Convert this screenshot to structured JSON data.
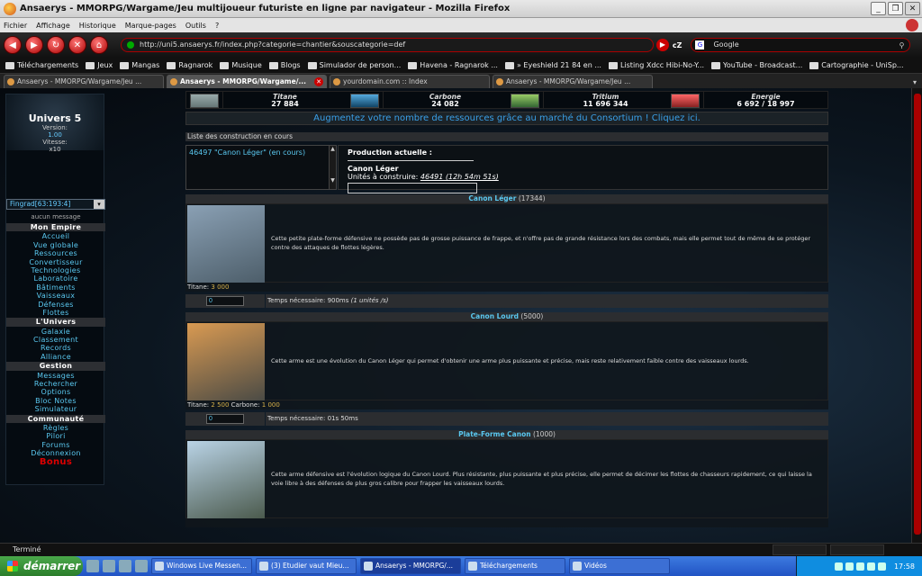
{
  "window": {
    "title": "Ansaerys - MMORPG/Wargame/Jeu multijoueur futuriste en ligne par navigateur - Mozilla Firefox"
  },
  "menu": [
    "Fichier",
    "Affichage",
    "Historique",
    "Marque-pages",
    "Outils",
    "?"
  ],
  "nav": {
    "url": "http://uni5.ansaerys.fr/index.php?categorie=chantier&souscategorie=def",
    "search": "Google"
  },
  "bookmarks": [
    "Téléchargements",
    "Jeux",
    "Mangas",
    "Ragnarok",
    "Musique",
    "Blogs",
    "Simulador de person...",
    "Havena - Ragnarok ...",
    "» Eyeshield 21 84 en ...",
    "Listing Xdcc Hibi-No-Y...",
    "YouTube - Broadcast...",
    "Cartographie - UniSp..."
  ],
  "tabs": [
    "Ansaerys - MMORPG/Wargame/Jeu ...",
    "Ansaerys - MMORPG/Wargame/...",
    "yourdomain.com :: Index",
    "Ansaerys - MMORPG/Wargame/Jeu ..."
  ],
  "sidebar": {
    "universe": "Univers 5",
    "version_label": "Version:",
    "version": "1.00",
    "speed_label": "Vitesse:",
    "speed": "x10",
    "planet": "Fingrad[63:193:4]",
    "message": "aucun message",
    "items": [
      {
        "label": "Mon Empire",
        "header": true
      },
      {
        "label": "Accueil"
      },
      {
        "label": "Vue globale"
      },
      {
        "label": "Ressources"
      },
      {
        "label": "Convertisseur"
      },
      {
        "label": "Technologies"
      },
      {
        "label": "Laboratoire"
      },
      {
        "label": "Bâtiments"
      },
      {
        "label": "Vaisseaux"
      },
      {
        "label": "Défenses"
      },
      {
        "label": "Flottes"
      },
      {
        "label": "L'Univers",
        "header": true
      },
      {
        "label": "Galaxie"
      },
      {
        "label": "Classement"
      },
      {
        "label": "Records"
      },
      {
        "label": "Alliance"
      },
      {
        "label": "Gestion",
        "header": true
      },
      {
        "label": "Messages"
      },
      {
        "label": "Rechercher"
      },
      {
        "label": "Options"
      },
      {
        "label": "Bloc Notes"
      },
      {
        "label": "Simulateur"
      },
      {
        "label": "Communauté",
        "header": true
      },
      {
        "label": "Règles"
      },
      {
        "label": "Pilori"
      },
      {
        "label": "Forums"
      },
      {
        "label": "Déconnexion"
      },
      {
        "label": "Bonus",
        "bonus": true
      }
    ]
  },
  "resources": [
    {
      "name": "Titane",
      "value": "27 884"
    },
    {
      "name": "Carbone",
      "value": "24 082"
    },
    {
      "name": "Tritium",
      "value": "11 696 344"
    },
    {
      "name": "Energie",
      "value": "6 692 / 18 997"
    }
  ],
  "promo": "Augmentez votre nombre de ressources grâce au marché du Consortium ! Cliquez ici.",
  "queue": {
    "title": "Liste des construction en cours",
    "item": "46497 \"Canon Léger\" (en cours)",
    "production_label": "Production actuelle :",
    "current": "Canon Léger",
    "remaining_label": "Unités à construire:",
    "remaining": "46491 (12h 54m 51s)"
  },
  "units": [
    {
      "name": "Canon Léger",
      "count": "(17344)",
      "desc": "Cette petite plate-forme défensive ne possède pas de grosse puissance de frappe, et n'offre pas de grande résistance lors des combats, mais elle permet tout de même de se protéger contre des attaques de flottes légères.",
      "cost": [
        {
          "label": "Titane:",
          "value": "3 000"
        }
      ],
      "qty": "0",
      "time": "Temps nécessaire: 900ms",
      "rate": "(1 unités /s)",
      "img": [
        "#8aa0b4",
        "#4d5e6a"
      ]
    },
    {
      "name": "Canon Lourd",
      "count": "(5000)",
      "desc": "Cette arme est une évolution du Canon Léger qui permet d'obtenir une arme plus puissante et précise, mais reste relativement faible contre des vaisseaux lourds.",
      "cost": [
        {
          "label": "Titane:",
          "value": "2 500"
        },
        {
          "label": "Carbone:",
          "value": "1 000"
        }
      ],
      "qty": "0",
      "time": "Temps nécessaire: 01s 50ms",
      "rate": "",
      "img": [
        "#d99a52",
        "#4b4b45"
      ]
    },
    {
      "name": "Plate-Forme Canon",
      "count": "(1000)",
      "desc": "Cette arme défensive est l'évolution logique du Canon Lourd. Plus résistante, plus puissante et plus précise, elle permet de décimer les flottes de chasseurs rapidement, ce qui laisse la voie libre à des défenses de plus gros calibre pour frapper les vaisseaux lourds.",
      "cost": [],
      "qty": "",
      "time": "",
      "rate": "",
      "img": [
        "#b9d3e6",
        "#4b5a4d"
      ]
    }
  ],
  "status": "Terminé",
  "taskbar": {
    "start": "démarrer",
    "items": [
      "Windows Live Messen...",
      "(3) Etudier vaut Mieu...",
      "Ansaerys - MMORPG/...",
      "Téléchargements",
      "Vidéos"
    ],
    "clock": "17:58"
  }
}
